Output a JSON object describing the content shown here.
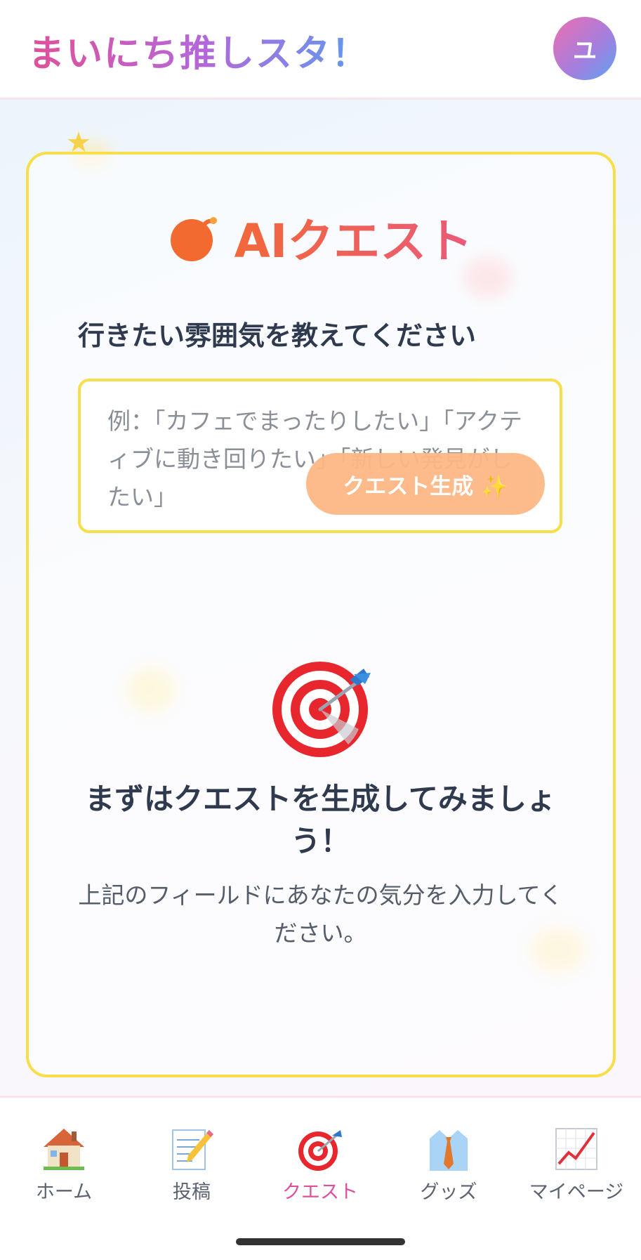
{
  "header": {
    "title": "まいにち推しスタ！",
    "avatar_initial": "ユ"
  },
  "quest": {
    "title": "AIクエスト",
    "question": "行きたい雰囲気を教えてください",
    "input_placeholder": "例：「カフェでまったりしたい」「アクティブに動き回りたい」「新しい発見がしたい」",
    "input_value": "",
    "generate_label": "クエスト生成 ✨"
  },
  "empty_state": {
    "title": "まずはクエストを生成してみましょう！",
    "description": "上記のフィールドにあなたの気分を入力してください。"
  },
  "nav": {
    "items": [
      {
        "label": "ホーム",
        "icon": "house-icon",
        "active": false
      },
      {
        "label": "投稿",
        "icon": "memo-icon",
        "active": false
      },
      {
        "label": "クエスト",
        "icon": "target-icon",
        "active": true
      },
      {
        "label": "グッズ",
        "icon": "shirt-icon",
        "active": false
      },
      {
        "label": "マイページ",
        "icon": "chart-icon",
        "active": false
      }
    ]
  },
  "colors": {
    "accent": "#e0509a",
    "card_border": "#f8de48",
    "button": "#fdb886",
    "text_dark": "#2f3a4f"
  }
}
